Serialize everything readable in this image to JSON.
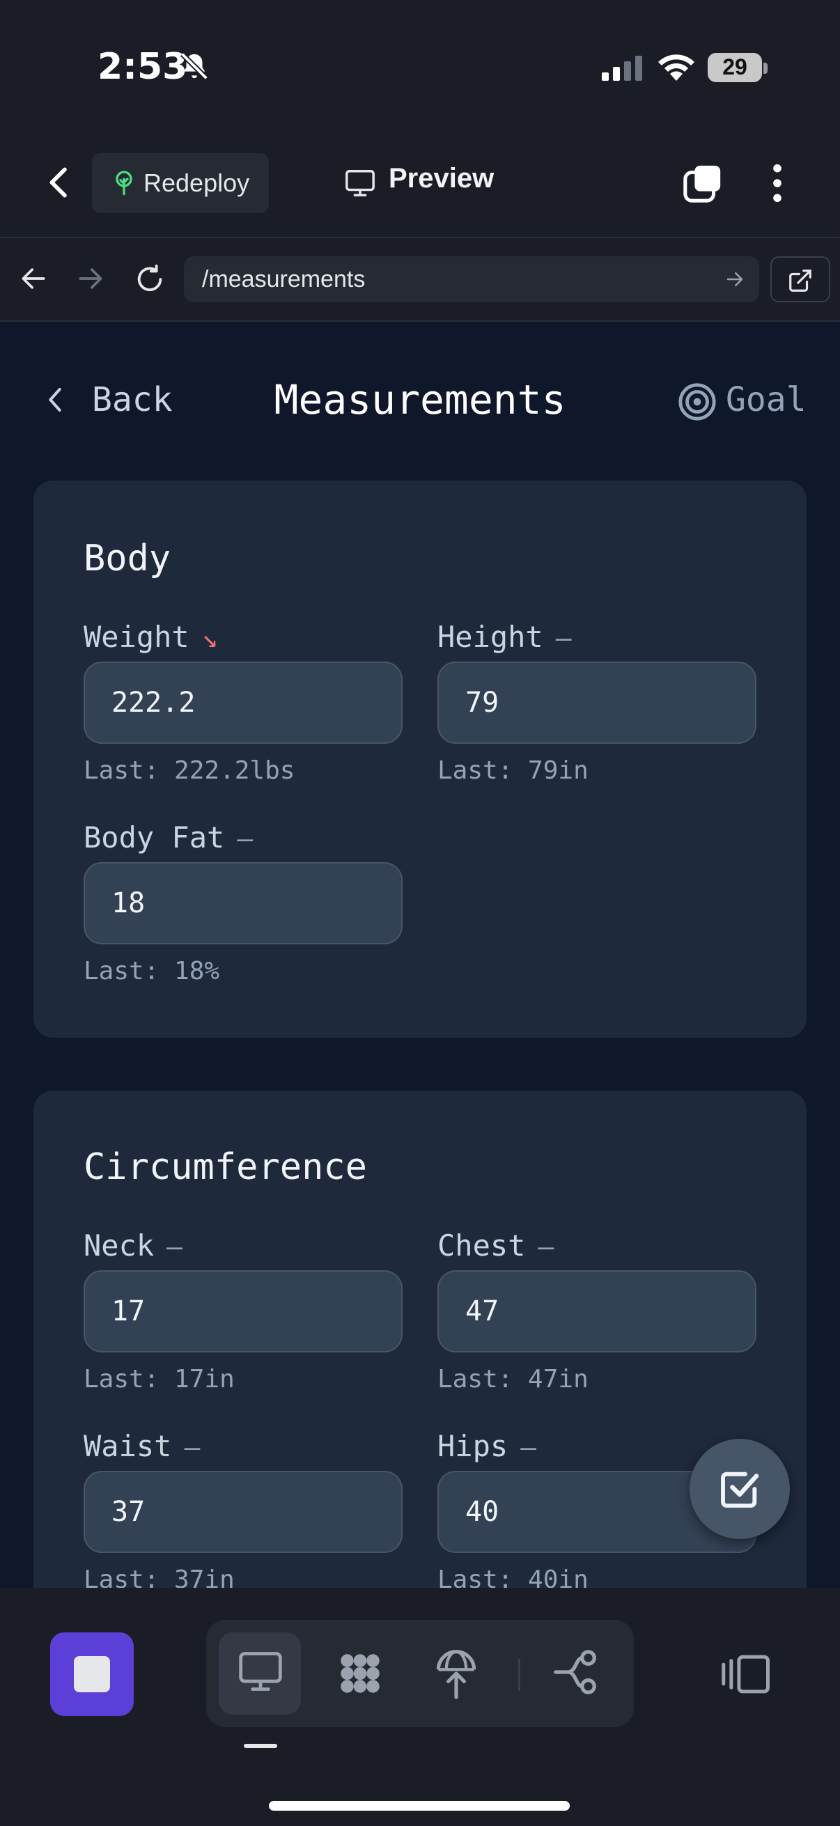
{
  "status_bar": {
    "time": "2:53",
    "battery": "29"
  },
  "app_header": {
    "redeploy_label": "Redeploy",
    "preview_label": "Preview"
  },
  "url_bar": {
    "url": "/measurements"
  },
  "page": {
    "back_label": "Back",
    "title": "Measurements",
    "goal_label": "Goal"
  },
  "body_section": {
    "title": "Body",
    "fields": [
      {
        "label": "Weight",
        "trend": "↘",
        "trend_color": "#f87171",
        "value": "222.2",
        "last": "Last: 222.2lbs"
      },
      {
        "label": "Height",
        "trend": "—",
        "value": "79",
        "last": "Last: 79in"
      },
      {
        "label": "Body Fat",
        "trend": "—",
        "value": "18",
        "last": "Last: 18%"
      }
    ]
  },
  "circumference_section": {
    "title": "Circumference",
    "fields": [
      {
        "label": "Neck",
        "trend": "—",
        "value": "17",
        "last": "Last: 17in"
      },
      {
        "label": "Chest",
        "trend": "—",
        "value": "47",
        "last": "Last: 47in"
      },
      {
        "label": "Waist",
        "trend": "—",
        "value": "37",
        "last": "Last: 37in"
      },
      {
        "label": "Hips",
        "trend": "—",
        "value": "40",
        "last": "Last: 40in"
      }
    ]
  },
  "colors": {
    "background": "#0f172a",
    "card": "#1e293b",
    "input": "#334155",
    "accent_stop": "#5b3fd6",
    "trend_down": "#f87171"
  },
  "icons": {
    "fab": "checkbox-check-icon",
    "toolbar": [
      "monitor-icon",
      "nodes-icon",
      "deploy-icon",
      "branch-icon",
      "panel-icon"
    ]
  }
}
